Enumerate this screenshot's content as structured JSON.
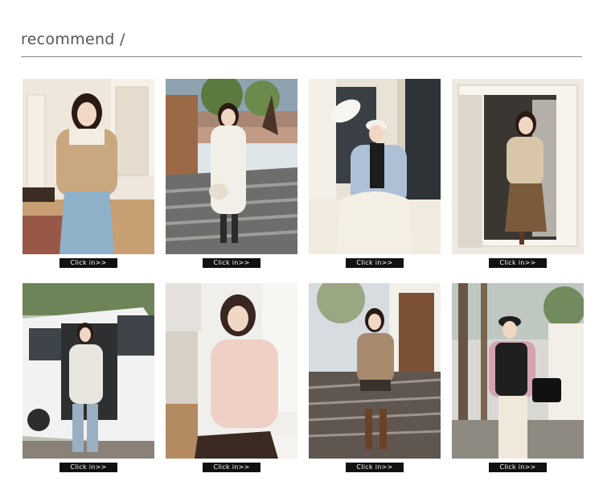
{
  "header": {
    "title": "recommend /"
  },
  "products": [
    {
      "id": "p1",
      "button_label": "Click in>>",
      "scene": "indoor-room",
      "jacket": "#c9a77f",
      "accent": "#e8dccb"
    },
    {
      "id": "p2",
      "button_label": "Click in>>",
      "scene": "stairs-garden",
      "jacket": "#f2efe8",
      "accent": "#2b2b2b"
    },
    {
      "id": "p3",
      "button_label": "Click in>>",
      "scene": "window-building",
      "jacket": "#aec0d6",
      "accent": "#1c1c1c"
    },
    {
      "id": "p4",
      "button_label": "Click in>>",
      "scene": "doorway",
      "jacket": "#d9c6a8",
      "accent": "#7b5a3c"
    },
    {
      "id": "p5",
      "button_label": "Click in>>",
      "scene": "white-van",
      "jacket": "#e9e6e0",
      "accent": "#4a4a4a"
    },
    {
      "id": "p6",
      "button_label": "Click in>>",
      "scene": "kitchen",
      "jacket": "#efd0c6",
      "accent": "#3a2a22"
    },
    {
      "id": "p7",
      "button_label": "Click in>>",
      "scene": "courtyard-steps",
      "jacket": "#a78a6e",
      "accent": "#6b4226"
    },
    {
      "id": "p8",
      "button_label": "Click in>>",
      "scene": "trees-street",
      "jacket": "#d5a3b0",
      "accent": "#1f1f1f"
    }
  ]
}
